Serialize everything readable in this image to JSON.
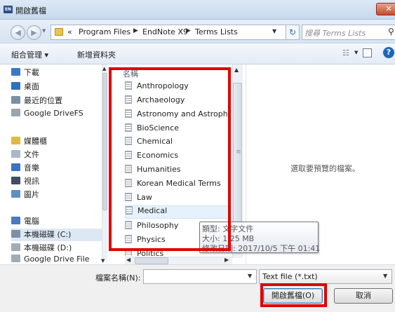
{
  "window": {
    "title": "開啟舊檔",
    "app_icon_text": "EN",
    "close_symbol": "✕"
  },
  "address_bar": {
    "back_symbol": "◀",
    "forward_symbol": "▶",
    "crumbs": [
      "«",
      "Program Files",
      "EndNote X9",
      "Terms Lists"
    ],
    "separator": "▶",
    "refresh_symbol": "↻",
    "search_placeholder": "搜尋 Terms Lists",
    "search_icon": "search-icon"
  },
  "toolbar": {
    "organize": "組合管理 ▾",
    "new_folder": "新增資料夾",
    "view_icon": "view-grid-icon",
    "help_symbol": "?"
  },
  "nav": {
    "items": [
      {
        "label": "下載",
        "icon": "download-folder-icon",
        "color": "#3b78c8"
      },
      {
        "label": "桌面",
        "icon": "desktop-icon",
        "color": "#2f6fbf"
      },
      {
        "label": "最近的位置",
        "icon": "recent-places-icon",
        "color": "#7a8fa6"
      },
      {
        "label": "Google DriveFS",
        "icon": "drive-icon",
        "color": "#9aa5b1"
      },
      {
        "label": "媒體櫃",
        "icon": "libraries-icon",
        "color": "#e0b940"
      },
      {
        "label": "文件",
        "icon": "documents-icon",
        "color": "#a9b7c9"
      },
      {
        "label": "音樂",
        "icon": "music-icon",
        "color": "#3a73c1"
      },
      {
        "label": "視訊",
        "icon": "videos-icon",
        "color": "#3f4e62"
      },
      {
        "label": "圖片",
        "icon": "pictures-icon",
        "color": "#5f8fc7"
      },
      {
        "label": "電腦",
        "icon": "computer-icon",
        "color": "#4a7bbd"
      },
      {
        "label": "本機磁碟 (C:)",
        "icon": "drive-c-icon",
        "color": "#7d8fa5"
      },
      {
        "label": "本機磁碟 (D:)",
        "icon": "drive-d-icon",
        "color": "#a2acb8"
      },
      {
        "label": "Google Drive File",
        "icon": "drive-icon",
        "color": "#a2acb8"
      }
    ]
  },
  "file_list": {
    "column_header": "名稱",
    "items": [
      "Anthropology",
      "Archaeology",
      "Astronomy and Astrophy",
      "BioScience",
      "Chemical",
      "Economics",
      "Humanities",
      "Korean Medical Terms",
      "Law",
      "Medical",
      "Philosophy",
      "Physics",
      "Politics"
    ],
    "hovered_item": "Medical"
  },
  "preview": {
    "message": "選取要預覽的檔案。"
  },
  "tooltip": {
    "type_line": "類型: 文字文件",
    "size_line": "大小: 1.25 MB",
    "date_line": "修改日期: 2017/10/5 下午 01:41"
  },
  "bottom": {
    "filename_label": "檔案名稱(N):",
    "filename_value": "",
    "filter_value": "Text file  (*.txt)",
    "open_button": "開啟舊檔(O)",
    "cancel_button": "取消"
  },
  "colors": {
    "annotation_red": "#e10000",
    "accent_blue": "#3c7fb1"
  }
}
